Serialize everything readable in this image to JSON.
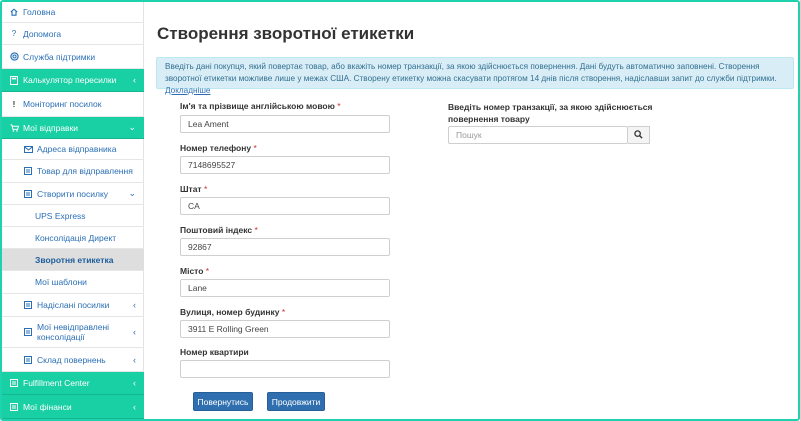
{
  "sidebar": {
    "items": [
      {
        "label": "Головна",
        "icon": "home-icon"
      },
      {
        "label": "Допомога",
        "icon": "help-icon"
      },
      {
        "label": "Служба підтримки",
        "icon": "support-icon"
      },
      {
        "label": "Калькулятор пересилки",
        "icon": "calculator-icon"
      },
      {
        "label": "Моніторинг посилок",
        "icon": "exclamation-icon"
      },
      {
        "label": "Мої відправки",
        "icon": "cart-icon"
      },
      {
        "label": "Адреса відправника",
        "icon": "envelope-icon"
      },
      {
        "label": "Товар для відправлення",
        "icon": "list-icon"
      },
      {
        "label": "Створити посилку",
        "icon": "list-icon"
      },
      {
        "label": "UPS Express"
      },
      {
        "label": "Консолідація Директ"
      },
      {
        "label": "Зворотня етикетка"
      },
      {
        "label": "Мої шаблони"
      },
      {
        "label": "Надіслані посилки",
        "icon": "list-icon"
      },
      {
        "label": "Мої невідправлені консолідації",
        "icon": "list-icon"
      },
      {
        "label": "Склад повернень",
        "icon": "list-icon"
      },
      {
        "label": "Fulfillment Center",
        "icon": "list-icon"
      },
      {
        "label": "Мої фінанси",
        "icon": "list-icon"
      }
    ],
    "accent_color": "#19cfa4"
  },
  "main": {
    "title": "Створення зворотної етикетки",
    "info_text": "Введіть дані покупця, який повертає товар, або вкажіть номер транзакції, за якою здійснюється повернення. Дані будуть автоматично заповнені. Створення зворотної етикетки можливе лише у межах США. Створену етикетку можна скасувати протягом 14 днів після створення, надіславши запит до служби підтримки.",
    "info_link": "Докладніше",
    "form": {
      "name_label": "Ім'я та прізвище англійською мовою",
      "name_value": "Lea Ament",
      "phone_label": "Номер телефону",
      "phone_value": "7148695527",
      "state_label": "Штат",
      "state_value": "CA",
      "zip_label": "Поштовий індекс",
      "zip_value": "92867",
      "city_label": "Місто",
      "city_value": "Lane",
      "street_label": "Вулиця, номер будинку",
      "street_value": "3911 E Rolling Green",
      "apt_label": "Номер квартири",
      "apt_value": "",
      "required_mark": "*"
    },
    "transaction": {
      "label": "Введіть номер транзакції, за якою здійснюється повернення товару",
      "placeholder": "Пошук"
    },
    "buttons": {
      "back": "Повернутись",
      "continue": "Продовжити"
    },
    "button_color": "#2f6faf"
  }
}
